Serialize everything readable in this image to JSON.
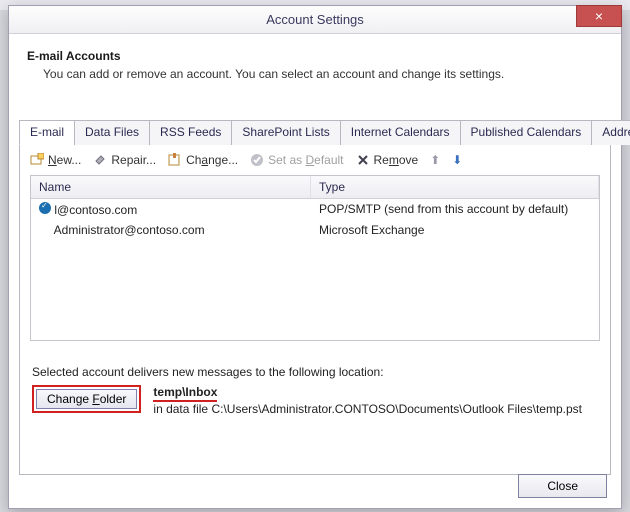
{
  "window": {
    "title": "Account Settings",
    "close": "×"
  },
  "header": {
    "title": "E-mail Accounts",
    "subtitle": "You can add or remove an account. You can select an account and change its settings."
  },
  "tabs": [
    {
      "label": "E-mail",
      "active": true
    },
    {
      "label": "Data Files"
    },
    {
      "label": "RSS Feeds"
    },
    {
      "label": "SharePoint Lists"
    },
    {
      "label": "Internet Calendars"
    },
    {
      "label": "Published Calendars"
    },
    {
      "label": "Address Books"
    }
  ],
  "toolbar": {
    "new": "New...",
    "repair": "Repair...",
    "change": "Change...",
    "set_default": "Set as Default",
    "remove": "Remove"
  },
  "columns": {
    "name": "Name",
    "type": "Type"
  },
  "accounts": [
    {
      "name": "     l@contoso.com",
      "type": "POP/SMTP (send from this account by default)",
      "default": true
    },
    {
      "name": "Administrator@contoso.com",
      "type": "Microsoft Exchange",
      "default": false
    }
  ],
  "deliver_note": "Selected account delivers new messages to the following location:",
  "folder": {
    "button": "Change Folder",
    "path_bold": "temp\\Inbox",
    "path_sub": "in data file C:\\Users\\Administrator.CONTOSO\\Documents\\Outlook Files\\temp.pst"
  },
  "footer": {
    "close": "Close"
  }
}
